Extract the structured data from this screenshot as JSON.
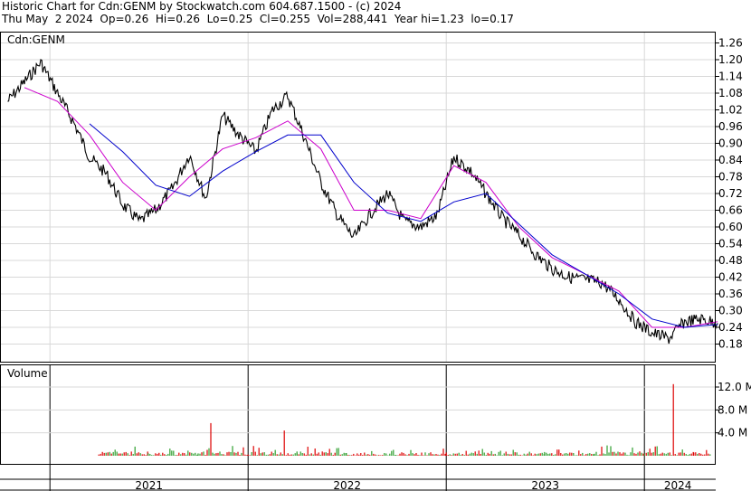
{
  "header": {
    "line1": "Historic Chart for Cdn:GENM by Stockwatch.com 604.687.1500 - (c) 2024",
    "line2": "Thu May  2 2024  Op=0.26  Hi=0.26  Lo=0.25  Cl=0.255  Vol=288,441  Year hi=1.23  lo=0.17"
  },
  "price_panel": {
    "label": "Cdn:GENM",
    "y_ticks": [
      "1.26",
      "1.20",
      "1.14",
      "1.08",
      "1.02",
      "0.96",
      "0.90",
      "0.84",
      "0.78",
      "0.72",
      "0.66",
      "0.60",
      "0.54",
      "0.48",
      "0.42",
      "0.36",
      "0.30",
      "0.24",
      "0.18"
    ]
  },
  "volume_panel": {
    "label": "Volume",
    "y_ticks": [
      "12.0 M",
      "8.0 M",
      "4.0 M"
    ]
  },
  "x_axis": {
    "years": [
      "2021",
      "2022",
      "2023",
      "2024"
    ]
  },
  "colors": {
    "price": "#000000",
    "ma_short": "#cc00cc",
    "ma_long": "#0000cc",
    "vol_up": "#2e9e2e",
    "vol_down": "#dd0000",
    "grid": "#d8d8d8"
  },
  "chart_data": [
    {
      "type": "line",
      "title": "Cdn:GENM",
      "y_unit": "CAD",
      "ylim": [
        0.15,
        1.29
      ],
      "grid": true,
      "series": [
        {
          "role": "close",
          "x": [
            "2020-10",
            "2020-11",
            "2020-12",
            "2021-01",
            "2021-02",
            "2021-03",
            "2021-04",
            "2021-05",
            "2021-06",
            "2021-07",
            "2021-08",
            "2021-09",
            "2021-10",
            "2021-11",
            "2021-12",
            "2022-01",
            "2022-02",
            "2022-03",
            "2022-04",
            "2022-05",
            "2022-06",
            "2022-07",
            "2022-08",
            "2022-09",
            "2022-10",
            "2022-11",
            "2022-12",
            "2023-01",
            "2023-02",
            "2023-03",
            "2023-04",
            "2023-05",
            "2023-06",
            "2023-07",
            "2023-08",
            "2023-09",
            "2023-10",
            "2023-11",
            "2023-12",
            "2024-01",
            "2024-02",
            "2024-03",
            "2024-04",
            "2024-05"
          ],
          "values": [
            1.05,
            1.12,
            1.19,
            1.08,
            0.97,
            0.85,
            0.79,
            0.68,
            0.62,
            0.66,
            0.74,
            0.86,
            0.7,
            1.0,
            0.93,
            0.87,
            1.02,
            1.07,
            0.92,
            0.76,
            0.64,
            0.56,
            0.65,
            0.72,
            0.62,
            0.6,
            0.64,
            0.85,
            0.8,
            0.72,
            0.63,
            0.57,
            0.5,
            0.45,
            0.42,
            0.41,
            0.4,
            0.34,
            0.26,
            0.22,
            0.2,
            0.26,
            0.27,
            0.255
          ]
        },
        {
          "role": "ma_short",
          "x": [
            "2020-11",
            "2021-01",
            "2021-03",
            "2021-05",
            "2021-07",
            "2021-09",
            "2021-11",
            "2022-01",
            "2022-03",
            "2022-05",
            "2022-07",
            "2022-09",
            "2022-11",
            "2023-01",
            "2023-03",
            "2023-05",
            "2023-07",
            "2023-09",
            "2023-11",
            "2024-01",
            "2024-03",
            "2024-05"
          ],
          "values": [
            1.1,
            1.05,
            0.93,
            0.76,
            0.66,
            0.78,
            0.88,
            0.92,
            0.98,
            0.88,
            0.66,
            0.66,
            0.63,
            0.82,
            0.76,
            0.6,
            0.49,
            0.43,
            0.37,
            0.24,
            0.24,
            0.26
          ]
        },
        {
          "role": "ma_long",
          "x": [
            "2021-03",
            "2021-05",
            "2021-07",
            "2021-09",
            "2021-11",
            "2022-01",
            "2022-03",
            "2022-05",
            "2022-07",
            "2022-09",
            "2022-11",
            "2023-01",
            "2023-03",
            "2023-05",
            "2023-07",
            "2023-09",
            "2023-11",
            "2024-01",
            "2024-03",
            "2024-05"
          ],
          "values": [
            0.97,
            0.87,
            0.75,
            0.71,
            0.8,
            0.87,
            0.93,
            0.93,
            0.76,
            0.65,
            0.62,
            0.69,
            0.72,
            0.61,
            0.5,
            0.43,
            0.36,
            0.27,
            0.24,
            0.25
          ]
        }
      ]
    },
    {
      "type": "bar",
      "title": "Volume",
      "y_unit": "M shares",
      "ylim": [
        0,
        14
      ],
      "categories": [
        "2021-Q2",
        "2021-Q3",
        "2021-Q4",
        "2022-Q1",
        "2022-Q2",
        "2022-Q3",
        "2022-Q4",
        "2023-Q1",
        "2023-Q2",
        "2023-Q3",
        "2023-Q4",
        "2024-Q1",
        "2024-Q2"
      ],
      "series": [
        {
          "role": "peak",
          "values": [
            1.6,
            0.9,
            5.7,
            4.4,
            1.2,
            0.8,
            1.0,
            0.9,
            0.7,
            0.9,
            1.8,
            12.5,
            1.0
          ]
        }
      ]
    }
  ]
}
